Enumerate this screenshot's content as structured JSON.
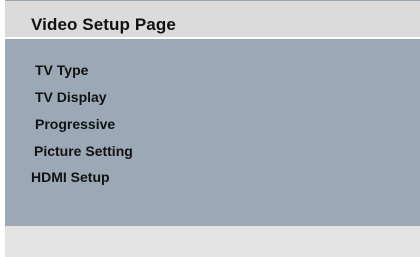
{
  "header": {
    "title": "Video Setup Page"
  },
  "menu": {
    "items": [
      {
        "label": "TV Type"
      },
      {
        "label": "TV Display"
      },
      {
        "label": "Progressive"
      },
      {
        "label": "Picture Setting"
      },
      {
        "label": "HDMI Setup"
      }
    ]
  },
  "colors": {
    "header_background": "#dbdbdb",
    "menu_background": "#9aa9b5",
    "footer_background": "#e3e3e3",
    "text": "#111111"
  }
}
